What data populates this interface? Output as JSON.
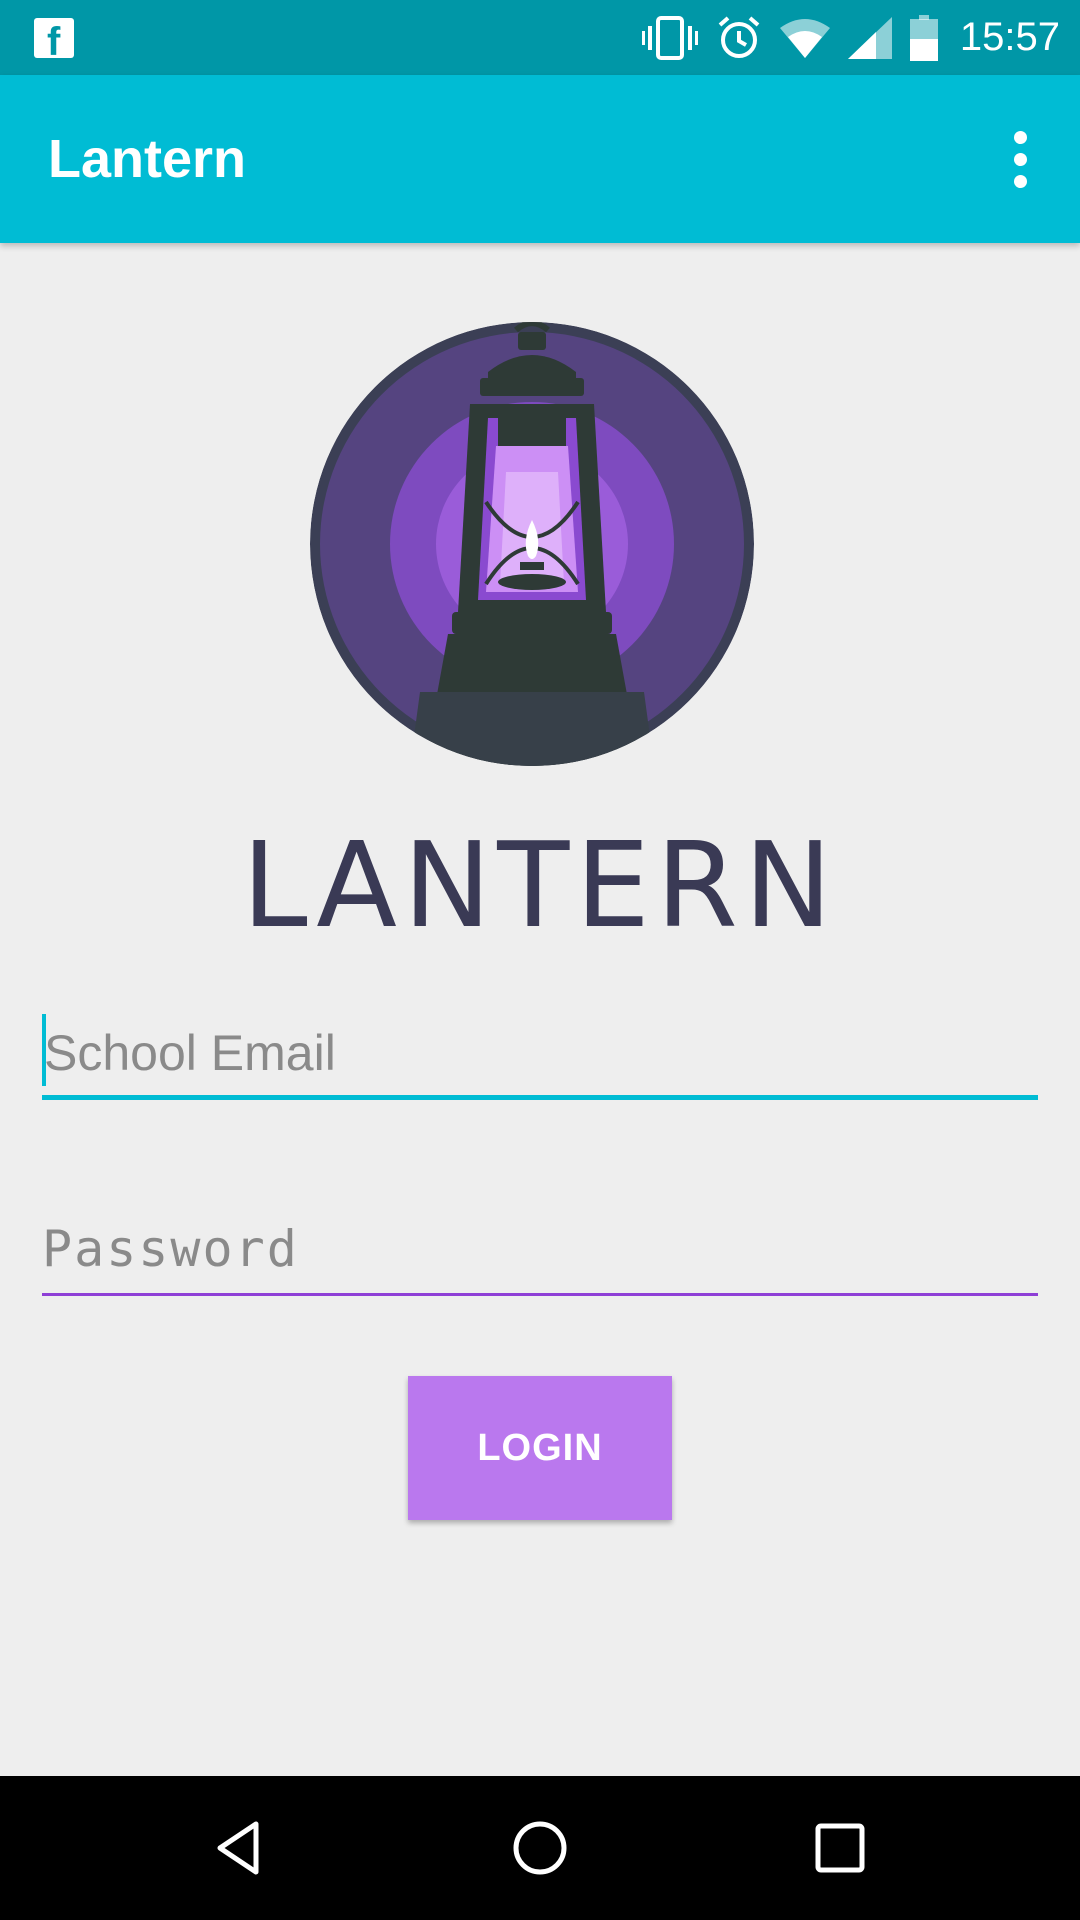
{
  "status_bar": {
    "time": "15:57",
    "notification_icon": "facebook-icon",
    "icons": [
      "vibrate-icon",
      "alarm-icon",
      "wifi-icon",
      "signal-icon",
      "battery-icon"
    ]
  },
  "app_bar": {
    "title": "Lantern",
    "overflow_icon": "more-vert-icon"
  },
  "logo": {
    "icon": "lantern-logo",
    "wordmark": "LANTERN"
  },
  "form": {
    "email": {
      "placeholder": "School Email",
      "value": ""
    },
    "password": {
      "placeholder": "Password",
      "value": ""
    },
    "login_label": "LOGIN"
  },
  "nav_bar": {
    "back_icon": "back-icon",
    "home_icon": "home-icon",
    "recents_icon": "recents-icon"
  },
  "colors": {
    "status_bar": "#0097a7",
    "app_bar": "#00bcd4",
    "accent_purple": "#8e3fd6",
    "button": "#ba78ee",
    "background": "#eeeeee"
  }
}
